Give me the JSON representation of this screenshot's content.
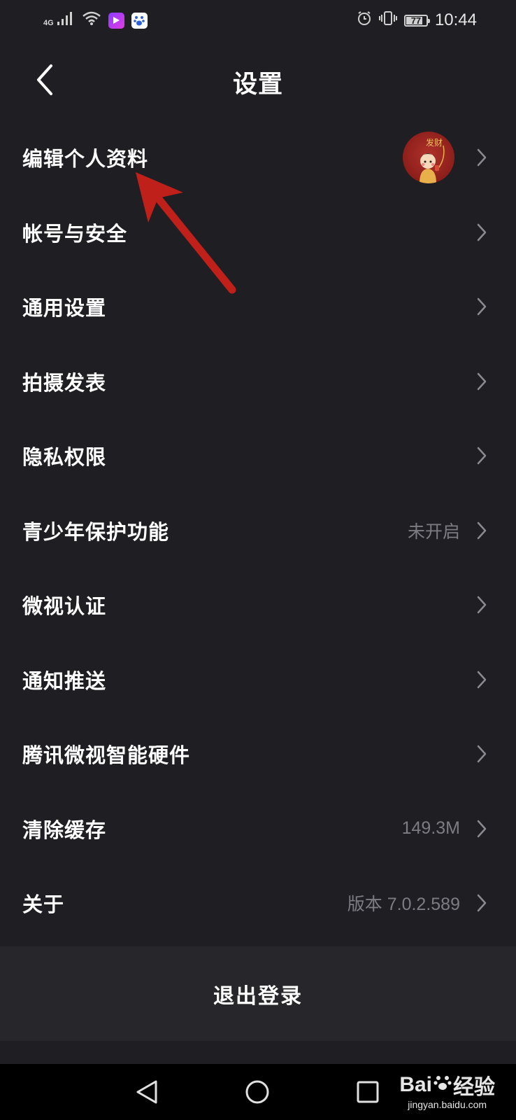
{
  "status_bar": {
    "network": "4G",
    "time": "10:44",
    "battery": "77",
    "icons": [
      "signal-icon",
      "wifi-icon",
      "video-app-icon",
      "baidu-app-icon",
      "alarm-icon",
      "vibrate-icon",
      "battery-icon"
    ]
  },
  "header": {
    "title": "设置",
    "back_icon": "chevron-left-icon"
  },
  "menu": {
    "items": [
      {
        "label": "编辑个人资料",
        "value": ""
      },
      {
        "label": "帐号与安全",
        "value": ""
      },
      {
        "label": "通用设置",
        "value": ""
      },
      {
        "label": "拍摄发表",
        "value": ""
      },
      {
        "label": "隐私权限",
        "value": ""
      },
      {
        "label": "青少年保护功能",
        "value": "未开启"
      },
      {
        "label": "微视认证",
        "value": ""
      },
      {
        "label": "通知推送",
        "value": ""
      },
      {
        "label": "腾讯微视智能硬件",
        "value": ""
      },
      {
        "label": "清除缓存",
        "value": "149.3M"
      },
      {
        "label": "关于",
        "value": "版本 7.0.2.589"
      }
    ],
    "avatar_text": "发财"
  },
  "logout": {
    "label": "退出登录"
  },
  "watermark": {
    "brand_prefix": "Bai",
    "brand_suffix": "经验",
    "url": "jingyan.baidu.com"
  },
  "colors": {
    "background": "#1e1e23",
    "logout_background": "#26262b",
    "secondary_text": "#7c7c82",
    "annotation_arrow": "#c0201a"
  }
}
